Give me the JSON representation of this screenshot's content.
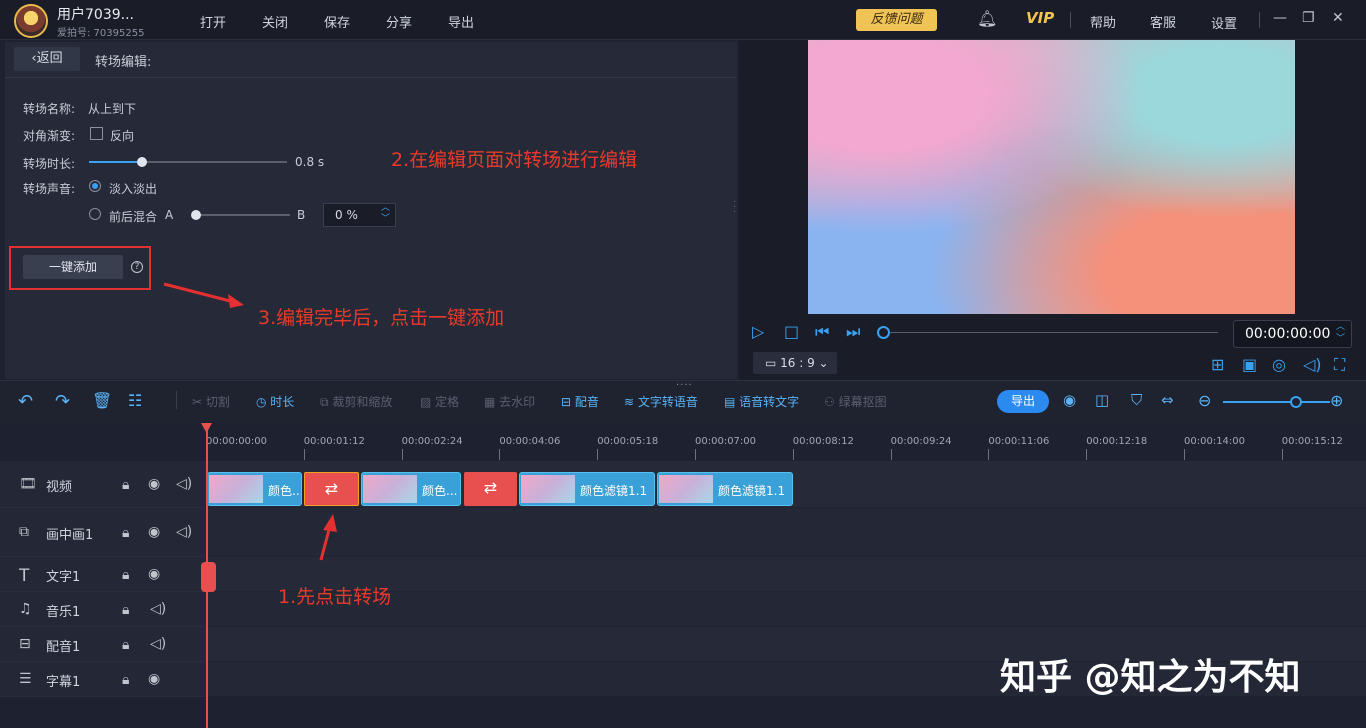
{
  "header": {
    "username": "用户7039...",
    "user_id": "爱拍号: 70395255",
    "menu": [
      "打开",
      "关闭",
      "保存",
      "分享",
      "导出"
    ],
    "feedback": "反馈问题",
    "vip": "VIP",
    "help": "帮助",
    "service": "客服",
    "settings": "设置"
  },
  "editor": {
    "back": "返回",
    "title": "转场编辑:",
    "name_label": "转场名称:",
    "name_value": "从上到下",
    "diag_label": "对角渐变:",
    "reverse": "反向",
    "duration_label": "转场时长:",
    "duration_value": "0.8 s",
    "duration_fraction": 0.27,
    "sound_label": "转场声音:",
    "fade": "淡入淡出",
    "mix": "前后混合",
    "mix_a": "A",
    "mix_b": "B",
    "mix_value": "0 %",
    "add_button": "一键添加",
    "help_glyph": "?"
  },
  "annotations": {
    "step1": "1.先点击转场",
    "step2": "2.在编辑页面对转场进行编辑",
    "step3": "3.编辑完毕后，点击一键添加"
  },
  "player": {
    "time": "00:00:00:00",
    "ratio": "16 : 9"
  },
  "toolbar": {
    "cut": "切割",
    "duration": "时长",
    "crop": "裁剪和缩放",
    "freeze": "定格",
    "watermark": "去水印",
    "dub": "配音",
    "tts": "文字转语音",
    "stt": "语音转文字",
    "greenscreen": "绿幕抠图",
    "export": "导出"
  },
  "ruler": [
    "00:00:00:00",
    "00:00:01:12",
    "00:00:02:24",
    "00:00:04:06",
    "00:00:05:18",
    "00:00:07:00",
    "00:00:08:12",
    "00:00:09:24",
    "00:00:11:06",
    "00:00:12:18",
    "00:00:14:00",
    "00:00:15:12"
  ],
  "tracks": [
    "视频",
    "画中画1",
    "文字1",
    "音乐1",
    "配音1",
    "字幕1"
  ],
  "clips": [
    "颜色...",
    "颜色...",
    "颜色滤镜1.1",
    "颜色滤镜1.1"
  ],
  "transition_glyph": "⇄",
  "watermark": "知乎 @知之为不知",
  "colors": {
    "accent": "#3aa0f0",
    "annotation": "#e83a2a",
    "transition": "#e85050"
  }
}
